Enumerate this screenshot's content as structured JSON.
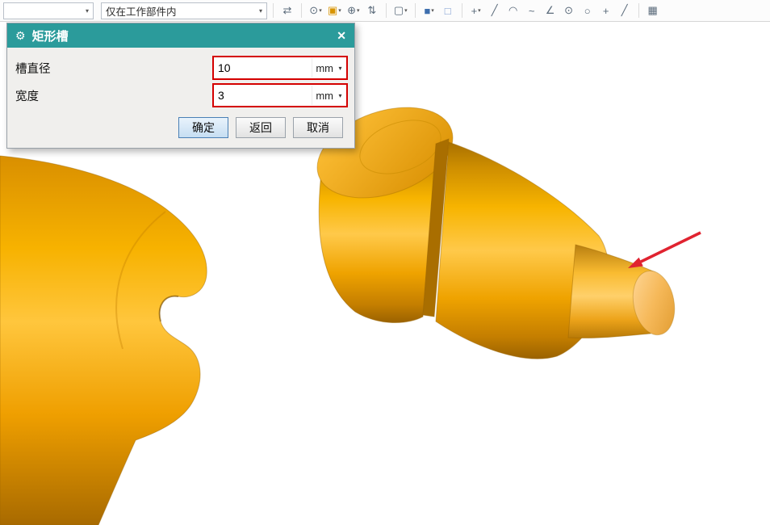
{
  "glyphs": {
    "chevron_down": "▾",
    "gear": "⚙",
    "close": "✕"
  },
  "toolbar": {
    "type_filter_combo": {
      "value": ""
    },
    "scope_combo": {
      "value": "仅在工作部件内"
    },
    "icons": [
      {
        "name": "assembly-sync",
        "glyph": "⇄"
      },
      {
        "name": "snap-point",
        "glyph": "⊙"
      },
      {
        "name": "work-plane",
        "glyph": "▣"
      },
      {
        "name": "datum-point",
        "glyph": "⊕"
      },
      {
        "name": "measure",
        "glyph": "⇅"
      },
      {
        "name": "selection-filter",
        "glyph": "▢"
      },
      {
        "name": "shaded-display",
        "glyph": "■"
      },
      {
        "name": "wireframe-display",
        "glyph": "□"
      },
      {
        "name": "move-object",
        "glyph": "+"
      },
      {
        "name": "line-tool",
        "glyph": "╱"
      },
      {
        "name": "arc-tool",
        "glyph": "◠"
      },
      {
        "name": "spline-tool",
        "glyph": "~"
      },
      {
        "name": "angle-snap",
        "glyph": "∠"
      },
      {
        "name": "point-on-curve",
        "glyph": "⊙"
      },
      {
        "name": "circle-snap",
        "glyph": "○"
      },
      {
        "name": "midpoint-snap",
        "glyph": "+"
      },
      {
        "name": "tangent-snap",
        "glyph": "╱"
      },
      {
        "name": "grid-display",
        "glyph": "▦"
      }
    ]
  },
  "dialog": {
    "title": "矩形槽",
    "fields": [
      {
        "label": "槽直径",
        "value": "10",
        "unit": "mm"
      },
      {
        "label": "宽度",
        "value": "3",
        "unit": "mm"
      }
    ],
    "buttons": {
      "ok": "确定",
      "back": "返回",
      "cancel": "取消"
    }
  },
  "canvas": {
    "model": "stepped-shaft",
    "colors": {
      "body": "#F2A800",
      "highlight": "#FFC94A",
      "shadow": "#A86A00",
      "arrow": "#E02330"
    }
  }
}
